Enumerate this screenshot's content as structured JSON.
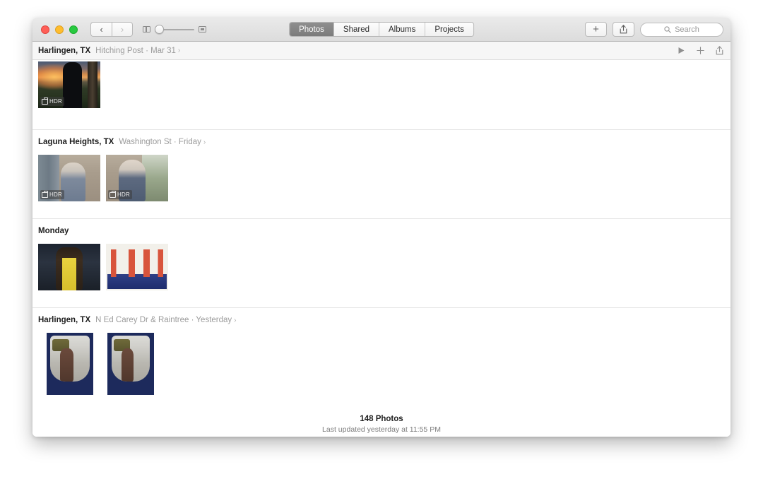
{
  "window": {
    "traffic_lights": [
      "close",
      "minimize",
      "zoom"
    ],
    "colors": {
      "close": "#ff5f57",
      "minimize": "#ffbd2e",
      "zoom": "#28c940",
      "accent_selected_segment": "#7b7b7b",
      "toolbar_bg": "#e3e3e3",
      "header_bg": "#f6f6f6"
    }
  },
  "toolbar": {
    "nav": {
      "back_icon": "chevron-left-icon",
      "forward_icon": "chevron-right-icon"
    },
    "zoom_slider": {
      "small_icon": "small-thumbnails-icon",
      "large_icon": "large-thumbnails-icon",
      "value": 0
    },
    "segments": [
      {
        "label": "Photos",
        "selected": true
      },
      {
        "label": "Shared",
        "selected": false
      },
      {
        "label": "Albums",
        "selected": false
      },
      {
        "label": "Projects",
        "selected": false
      }
    ],
    "add_label": "+",
    "share_icon": "share-icon",
    "search": {
      "icon": "search-icon",
      "placeholder": "Search",
      "value": ""
    }
  },
  "sticky_header": {
    "place": "Harlingen, TX",
    "subtitle": "Hitching Post  ·  Mar 31",
    "chevron": "›",
    "actions": {
      "play_icon": "play-icon",
      "add_icon": "plus-icon",
      "share_icon": "share-icon"
    }
  },
  "sections": [
    {
      "place": "Harlingen, TX",
      "subtitle": "Hitching Post  ·  Mar 31",
      "chevron": "›",
      "clipped": true,
      "photos": [
        {
          "name": "photo-sunset-silhouette",
          "orientation": "landscape",
          "badge": "HDR",
          "art": "img-sunset"
        }
      ]
    },
    {
      "place": "Laguna Heights, TX",
      "subtitle": "Washington St  ·  Friday",
      "chevron": "›",
      "clipped": false,
      "photos": [
        {
          "name": "photo-porch-portrait-1",
          "orientation": "landscape",
          "badge": "HDR",
          "art": "img-porch1"
        },
        {
          "name": "photo-porch-portrait-2",
          "orientation": "landscape",
          "badge": "HDR",
          "art": "img-porch2"
        }
      ]
    },
    {
      "place": "Monday",
      "subtitle": "",
      "chevron": "",
      "clipped": false,
      "photos": [
        {
          "name": "photo-gym-pullup",
          "orientation": "landscape",
          "badge": "",
          "art": "img-gym"
        },
        {
          "name": "photo-gym-inverted",
          "orientation": "landscape",
          "badge": "",
          "art": "img-gym-inv"
        }
      ]
    },
    {
      "place": "Harlingen, TX",
      "subtitle": "N Ed Carey Dr & Raintree  ·  Yesterday",
      "chevron": "›",
      "clipped": false,
      "photos": [
        {
          "name": "photo-stable-horse-1",
          "orientation": "portrait",
          "badge": "",
          "art": "img-stable"
        },
        {
          "name": "photo-stable-horse-2",
          "orientation": "portrait",
          "badge": "",
          "art": "img-stable framed"
        }
      ]
    }
  ],
  "footer": {
    "count": "148 Photos",
    "updated": "Last updated yesterday at 11:55 PM"
  }
}
